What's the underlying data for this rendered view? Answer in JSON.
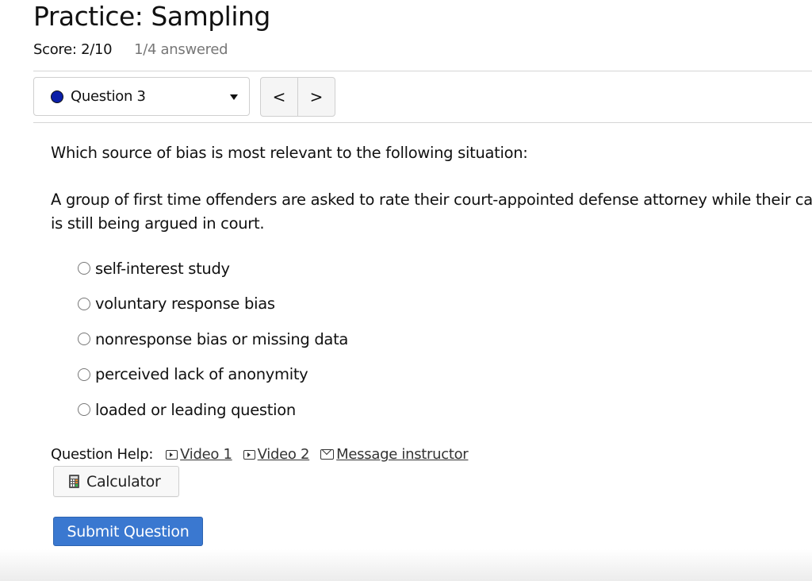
{
  "header": {
    "title": "Practice: Sampling",
    "score": "Score: 2/10",
    "answered": "1/4 answered"
  },
  "question_nav": {
    "selected_question": "Question 3",
    "status_dot_color": "#0b1fa8",
    "prev_label": "<",
    "next_label": ">"
  },
  "question": {
    "prompt": "Which source of bias is most relevant to the following situation:",
    "situation": "A group of first time offenders are asked to rate their court-appointed defense attorney while their case is still being argued in court.",
    "choices": [
      {
        "label": "self-interest study",
        "selected": false
      },
      {
        "label": "voluntary response bias",
        "selected": false
      },
      {
        "label": "nonresponse bias or missing data",
        "selected": false
      },
      {
        "label": "perceived lack of anonymity",
        "selected": false
      },
      {
        "label": "loaded or leading question",
        "selected": false
      }
    ]
  },
  "help": {
    "label": "Question Help:",
    "links": [
      {
        "icon": "video-icon",
        "label": "Video 1"
      },
      {
        "icon": "video-icon",
        "label": "Video 2"
      },
      {
        "icon": "mail-icon",
        "label": "Message instructor"
      }
    ],
    "calculator_label": "Calculator"
  },
  "submit": {
    "label": "Submit Question",
    "color": "#3a78d0"
  }
}
